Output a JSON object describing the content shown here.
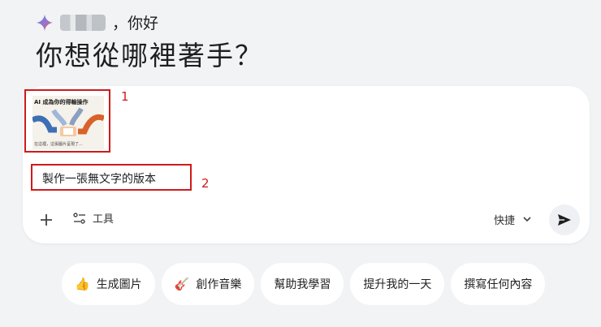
{
  "greeting": {
    "name_blurred": true,
    "suffix": "，你好"
  },
  "headline": "你想從哪裡著手？",
  "attachment": {
    "thumbnail_title": "AI 成為你的得輸操作",
    "thumbnail_caption": "在這裡，這張圖片呈現了..."
  },
  "annotations": {
    "one": "1",
    "two": "2"
  },
  "prompt": {
    "text": "製作一張無文字的版本"
  },
  "toolbar": {
    "tools_label": "工具",
    "mode_label": "快捷"
  },
  "chips": [
    {
      "icon": "👍",
      "label": "生成圖片"
    },
    {
      "icon": "🎸",
      "label": "創作音樂"
    },
    {
      "icon": "",
      "label": "幫助我學習"
    },
    {
      "icon": "",
      "label": "提升我的一天"
    },
    {
      "icon": "",
      "label": "撰寫任何內容"
    }
  ],
  "colors": {
    "annotation_red": "#d11a1a",
    "background": "#f1f3f5"
  }
}
